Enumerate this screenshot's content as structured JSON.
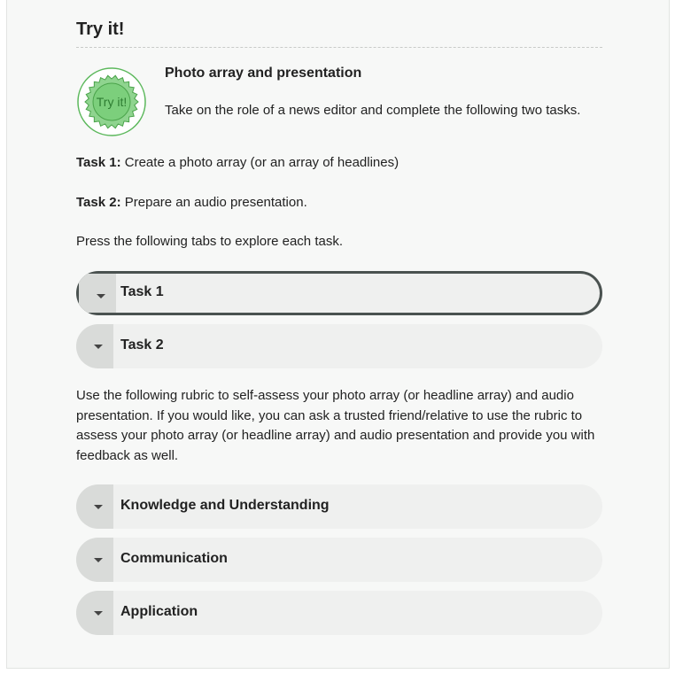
{
  "heading": "Try it!",
  "badge": {
    "icon": "try-it-badge-icon",
    "text": "Try it!",
    "color": "#5cb85c"
  },
  "intro": {
    "title": "Photo array and presentation",
    "text": "Take on the role of a news editor and complete the following two tasks."
  },
  "tasks": [
    {
      "label": "Task 1:",
      "text": " Create a photo array (or an array of headlines)"
    },
    {
      "label": "Task 2:",
      "text": " Prepare an audio presentation."
    }
  ],
  "instruction": "Press the following tabs to explore each task.",
  "task_tabs": [
    {
      "label": "Task 1",
      "focused": true
    },
    {
      "label": "Task 2",
      "focused": false
    }
  ],
  "rubric_text": "Use the following rubric to self-assess your photo array (or headline array) and audio presentation. If you would like, you can ask a trusted friend/relative to use the rubric to assess your photo array (or headline array) and audio presentation and provide you with feedback as well.",
  "rubric_tabs": [
    {
      "label": "Knowledge and Understanding"
    },
    {
      "label": "Communication"
    },
    {
      "label": "Application"
    }
  ]
}
